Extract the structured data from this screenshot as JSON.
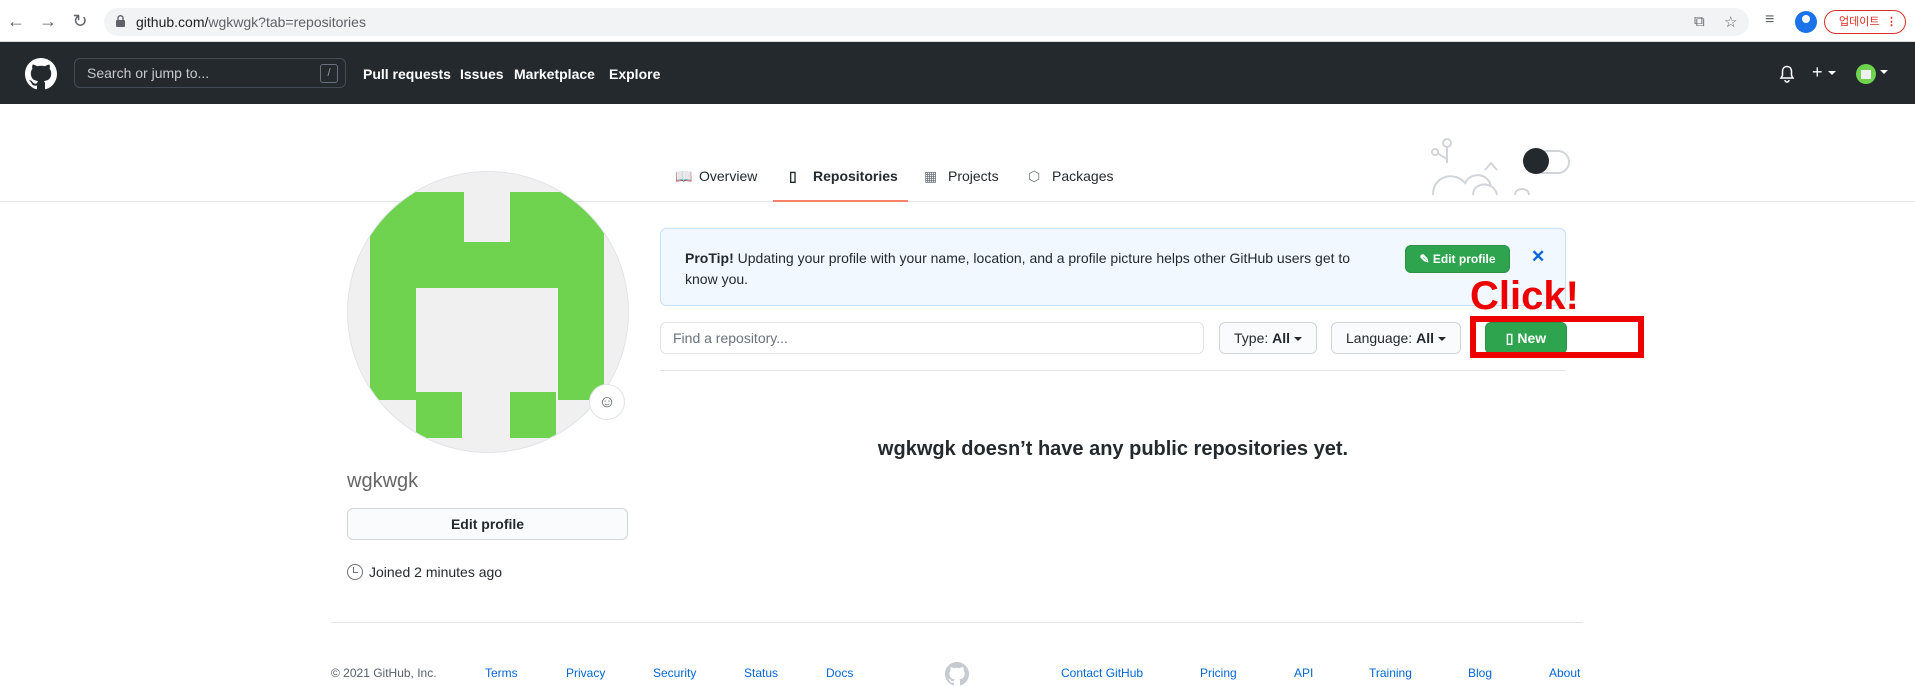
{
  "browser": {
    "url_host": "github.com/",
    "url_path": "wgkwgk?tab=repositories",
    "update_label": "업데이트",
    "menu_icon": "vertical-dots-icon"
  },
  "header": {
    "search_placeholder": "Search or jump to...",
    "search_shortcut": "/",
    "nav": [
      "Pull requests",
      "Issues",
      "Marketplace",
      "Explore"
    ],
    "plus": "+"
  },
  "tabs": [
    {
      "label": "Overview",
      "icon": "book-icon"
    },
    {
      "label": "Repositories",
      "icon": "repo-icon"
    },
    {
      "label": "Projects",
      "icon": "project-icon"
    },
    {
      "label": "Packages",
      "icon": "package-icon"
    }
  ],
  "profile": {
    "username": "wgkwgk",
    "edit_profile": "Edit profile",
    "joined": "Joined 2 minutes ago",
    "avatar_color": "#6fd34f"
  },
  "protip": {
    "label": "ProTip!",
    "text": " Updating your profile with your name, location, and a profile picture helps other GitHub users get to know you.",
    "button": "Edit profile",
    "close": "✕"
  },
  "filters": {
    "find_placeholder": "Find a repository...",
    "type_label": "Type:",
    "type_value": "All",
    "language_label": "Language:",
    "language_value": "All",
    "new_button": "New"
  },
  "empty_message": "wgkwgk doesn’t have any public repositories yet.",
  "annotation": {
    "text": "Click!",
    "color": "#ee0000"
  },
  "footer": {
    "copyright": "© 2021 GitHub, Inc.",
    "links_left": [
      "Terms",
      "Privacy",
      "Security",
      "Status",
      "Docs"
    ],
    "links_right": [
      "Contact GitHub",
      "Pricing",
      "API",
      "Training",
      "Blog",
      "About"
    ]
  },
  "colors": {
    "header_bg": "#24292e",
    "primary_green": "#2ea44f",
    "link_blue": "#0366d6",
    "active_tab_underline": "#f9826c"
  }
}
